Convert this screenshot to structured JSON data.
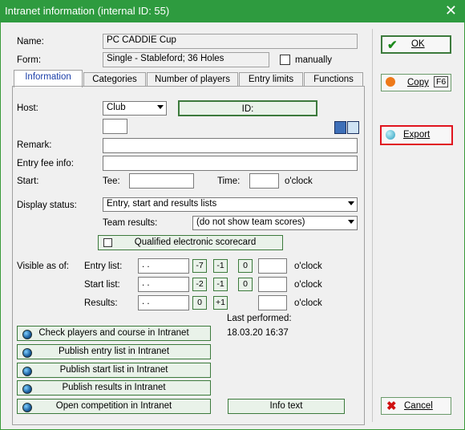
{
  "window": {
    "title": "Intranet information (internal ID: 55)",
    "close": "✕"
  },
  "fields": {
    "name_label": "Name:",
    "name_value": "PC CADDIE Cup",
    "form_label": "Form:",
    "form_value": "Single - Stableford; 36 Holes",
    "manually_label": "manually"
  },
  "tabs": [
    "Information",
    "Categories",
    "Number of players",
    "Entry limits",
    "Functions"
  ],
  "info": {
    "host_label": "Host:",
    "host_value": "Club",
    "id_button": "ID:",
    "remark_label": "Remark:",
    "entry_fee_label": "Entry fee info:",
    "start_label": "Start:",
    "tee_label": "Tee:",
    "time_label": "Time:",
    "oclock": "o'clock",
    "display_status_label": "Display status:",
    "display_status_value": "Entry, start and results lists",
    "team_results_label": "Team results:",
    "team_results_value": "(do not show team scores)",
    "qualified_label": "Qualified electronic scorecard",
    "visible_as_of_label": "Visible as of:",
    "entry_list_label": "Entry list:",
    "start_list_label": "Start list:",
    "results_label": "Results:",
    "date_placeholder": " .  .",
    "entry_offsets": [
      "-7",
      "-1",
      "0"
    ],
    "start_offsets": [
      "-2",
      "-1",
      "0"
    ],
    "results_offsets": [
      "0",
      "+1"
    ],
    "last_performed_label": "Last performed:",
    "last_performed_value": "18.03.20 16:37"
  },
  "actions": {
    "check": "Check players and course in Intranet",
    "publish_entry": "Publish entry list in Intranet",
    "publish_start": "Publish start list in Intranet",
    "publish_results": "Publish results in Intranet",
    "open_competition": "Open competition in Intranet",
    "info_text": "Info text"
  },
  "right": {
    "ok": "OK",
    "copy": "Copy",
    "copy_key": "F6",
    "export": "Export",
    "cancel": "Cancel"
  },
  "colors": {
    "title_bar": "#2e9b3f",
    "highlight": "#e0141e",
    "tab_active_text": "#1a3ea8"
  }
}
